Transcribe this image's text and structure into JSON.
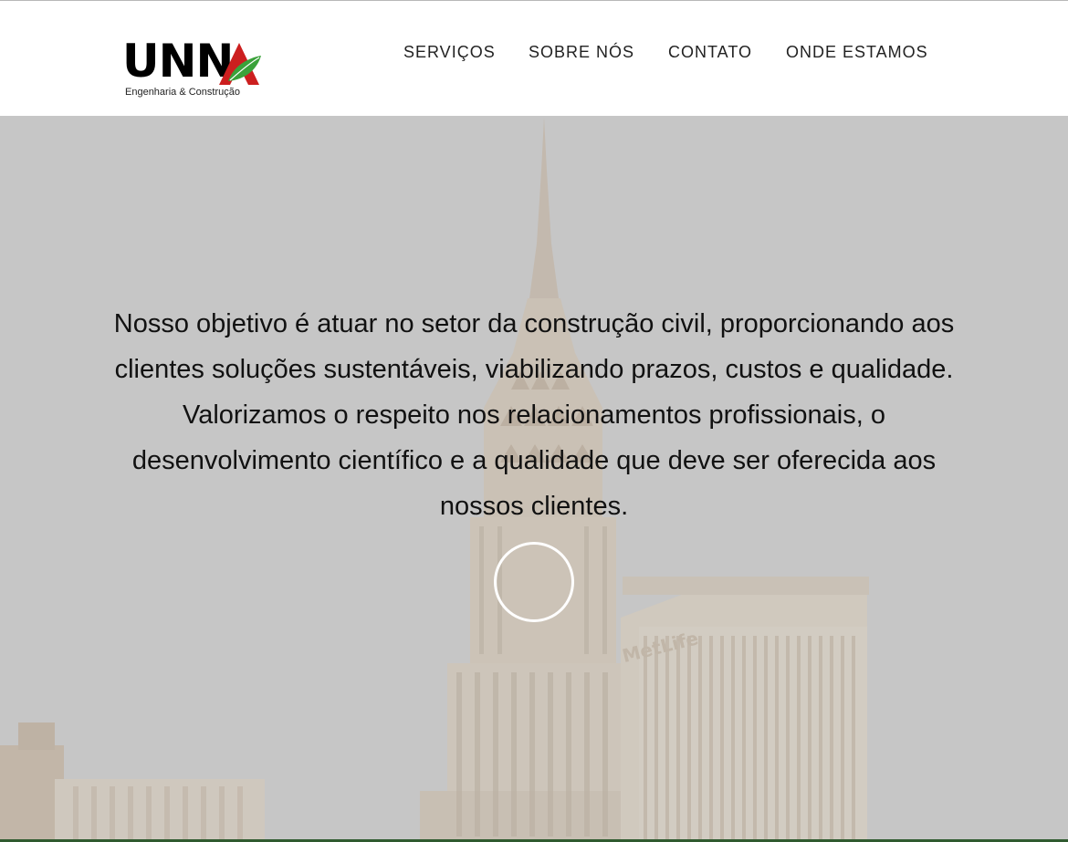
{
  "header": {
    "logo": {
      "word": "UNNA",
      "word_visible": "UNN",
      "tagline": "Engenharia & Construção",
      "colors": {
        "text": "#000000",
        "triangle": "#cc1f1f",
        "leaf": "#3aa23a"
      }
    },
    "nav": [
      {
        "label": "SERVIÇOS"
      },
      {
        "label": "SOBRE NÓS"
      },
      {
        "label": "CONTATO"
      },
      {
        "label": "ONDE ESTAMOS"
      }
    ]
  },
  "hero": {
    "text": "Nosso objetivo é atuar no setor da construção civil, proporcionando aos clientes soluções sustentáveis, viabilizando prazos, custos e qualidade. Valorizamos o respeito nos relacionamentos profissionais, o desenvolvimento científico e a qualidade que deve ser oferecida aos nossos clientes.",
    "background_sign": "MetLife",
    "colors": {
      "overlay": "#c6c6c6",
      "text": "#111111",
      "circle": "#ffffff",
      "accent_bar": "#2f5a2f"
    }
  }
}
